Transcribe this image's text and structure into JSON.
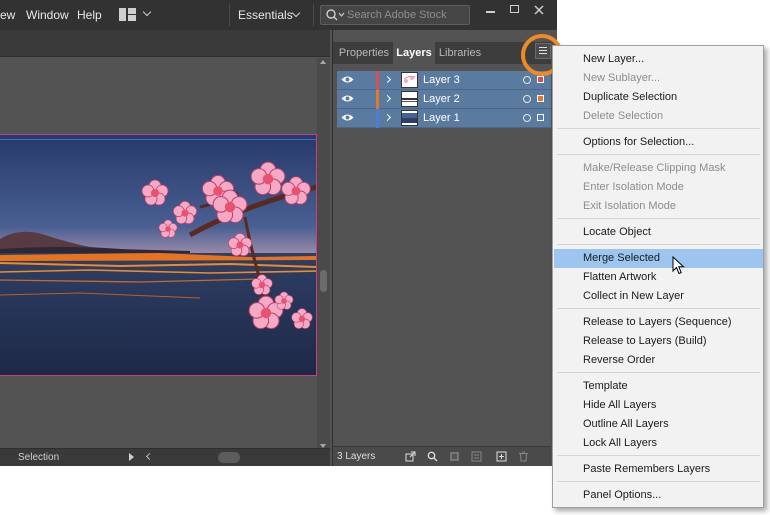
{
  "menubar": {
    "items": [
      "ew",
      "Window",
      "Help"
    ],
    "workspace": "Essentials",
    "search_placeholder": "Search Adobe Stock"
  },
  "status": {
    "tool": "Selection"
  },
  "layers_panel": {
    "tabs": [
      {
        "label": "Properties",
        "active": false
      },
      {
        "label": "Layers",
        "active": true
      },
      {
        "label": "Libraries",
        "active": false
      }
    ],
    "layers": [
      {
        "name": "Layer 3",
        "color": "#d94f4f"
      },
      {
        "name": "Layer 2",
        "color": "#e07a25"
      },
      {
        "name": "Layer 1",
        "color": "#4f7cd9"
      }
    ],
    "layer_count": "3 Layers"
  },
  "flyout": {
    "items": [
      {
        "label": "New Layer...",
        "disabled": false
      },
      {
        "label": "New Sublayer...",
        "disabled": true
      },
      {
        "label": "Duplicate Selection",
        "disabled": false
      },
      {
        "label": "Delete Selection",
        "disabled": true
      },
      {
        "label": "Options for Selection...",
        "disabled": false
      },
      {
        "label": "Make/Release Clipping Mask",
        "disabled": true
      },
      {
        "label": "Enter Isolation Mode",
        "disabled": true
      },
      {
        "label": "Exit Isolation Mode",
        "disabled": true
      },
      {
        "label": "Locate Object",
        "disabled": false
      },
      {
        "label": "Merge Selected",
        "disabled": false,
        "highlighted": true
      },
      {
        "label": "Flatten Artwork",
        "disabled": false
      },
      {
        "label": "Collect in New Layer",
        "disabled": false
      },
      {
        "label": "Release to Layers (Sequence)",
        "disabled": false
      },
      {
        "label": "Release to Layers (Build)",
        "disabled": false
      },
      {
        "label": "Reverse Order",
        "disabled": false
      },
      {
        "label": "Template",
        "disabled": false
      },
      {
        "label": "Hide All Layers",
        "disabled": false
      },
      {
        "label": "Outline All Layers",
        "disabled": false
      },
      {
        "label": "Lock All Layers",
        "disabled": false
      },
      {
        "label": "Paste Remembers Layers",
        "disabled": false
      },
      {
        "label": "Panel Options...",
        "disabled": false
      }
    ]
  },
  "icons": {
    "workspace": "workspace-grid-icon",
    "search": "search-icon",
    "panel_menu": "hamburger-menu-icon",
    "visibility": "eye-icon",
    "expand": "chevron-right-icon",
    "footer": [
      "export-icon",
      "locate-search-icon",
      "clipping-mask-icon",
      "new-sublayer-icon",
      "new-layer-icon",
      "trash-icon"
    ]
  },
  "colors": {
    "accent_highlight": "#f08a24",
    "menu_hover": "#9cc5f0",
    "layer_selected": "#5b7a9f"
  }
}
